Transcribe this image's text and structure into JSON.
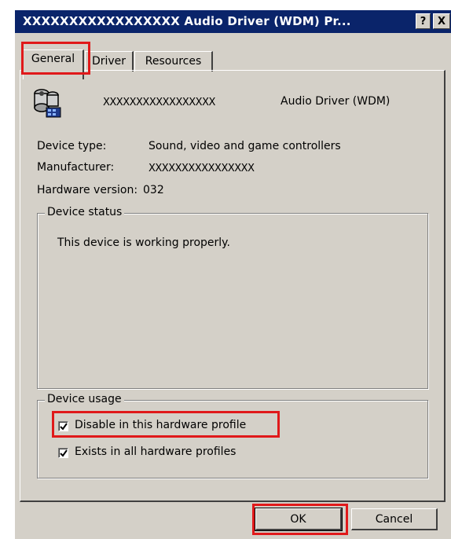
{
  "window": {
    "title": "XXXXXXXXXXXXXXXXX  Audio Driver (WDM) Pr...",
    "help_label": "?",
    "close_label": "X"
  },
  "tabs": [
    {
      "label": "General",
      "active": true
    },
    {
      "label": "Driver",
      "active": false
    },
    {
      "label": "Resources",
      "active": false
    }
  ],
  "device": {
    "icon": "audio-device-icon",
    "name_mask": "XXXXXXXXXXXXXXXXX",
    "name_suffix": "Audio Driver (WDM)"
  },
  "properties": {
    "device_type_label": "Device type:",
    "device_type_value": "Sound, video and game controllers",
    "manufacturer_label": "Manufacturer:",
    "manufacturer_value": "XXXXXXXXXXXXXXXX",
    "hardware_version_label": "Hardware version:",
    "hardware_version_value": "032"
  },
  "device_status": {
    "legend": "Device status",
    "text": "This device is working properly."
  },
  "device_usage": {
    "legend": "Device usage",
    "options": [
      {
        "label": "Disable in this hardware profile",
        "checked": true
      },
      {
        "label": "Exists in all hardware profiles",
        "checked": true
      }
    ]
  },
  "buttons": {
    "ok_label": "OK",
    "cancel_label": "Cancel"
  },
  "colors": {
    "titlebar": "#0a246a",
    "dialog_face": "#d4d0c8",
    "annotation_red": "#e0191a"
  }
}
